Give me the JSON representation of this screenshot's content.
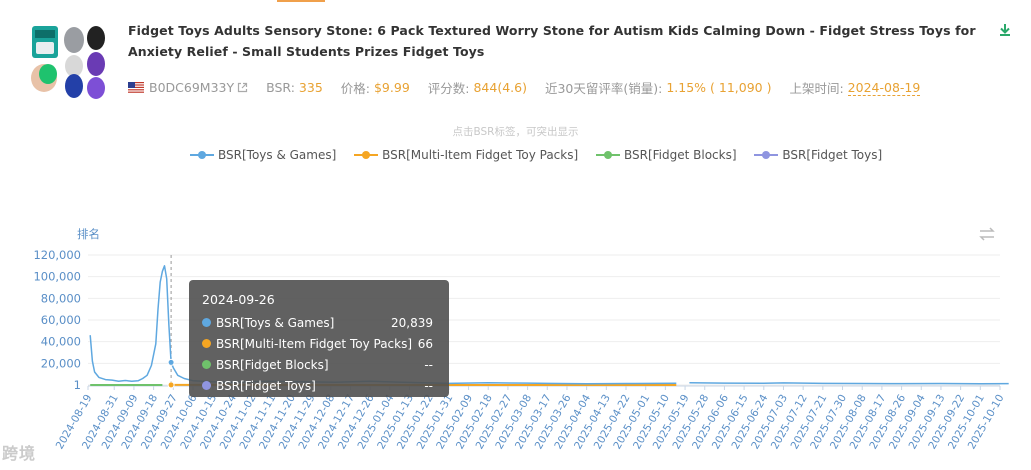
{
  "product": {
    "title": "Fidget Toys Adults Sensory Stone: 6 Pack Textured Worry Stone for Autism Kids Calming Down - Fidget Stress Toys for Anxiety Relief - Small Students Prizes Fidget Toys",
    "asin": "B0DC69M33Y",
    "bsr_label": "BSR:",
    "bsr_value": "335",
    "price_label": "价格:",
    "price_value": "$9.99",
    "reviews_label": "评分数:",
    "reviews_value": "844(4.6)",
    "retention_label": "近30天留评率(销量):",
    "retention_value": "1.15% ( 11,090 )",
    "listed_label": "上架时间:",
    "listed_value": "2024-08-19"
  },
  "chart_hint": "点击BSR标签，可突出显示",
  "axis_title": "排名",
  "legend": [
    {
      "name": "BSR[Toys & Games]",
      "color": "#5fa8e0"
    },
    {
      "name": "BSR[Multi-Item Fidget Toy Packs]",
      "color": "#f5a623"
    },
    {
      "name": "BSR[Fidget Blocks]",
      "color": "#6fc26b"
    },
    {
      "name": "BSR[Fidget Toys]",
      "color": "#8f95e0"
    }
  ],
  "tooltip": {
    "date": "2024-09-26",
    "rows": [
      {
        "name": "BSR[Toys & Games]",
        "value": "20,839",
        "color": "#5fa8e0"
      },
      {
        "name": "BSR[Multi-Item Fidget Toy Packs]",
        "value": "66",
        "color": "#f5a623"
      },
      {
        "name": "BSR[Fidget Blocks]",
        "value": "--",
        "color": "#6fc26b"
      },
      {
        "name": "BSR[Fidget Toys]",
        "value": "--",
        "color": "#8f95e0"
      }
    ]
  },
  "watermark": "跨境",
  "chart_data": {
    "type": "line",
    "ylabel": "排名",
    "y_ticks": [
      "120,000",
      "100,000",
      "80,000",
      "60,000",
      "40,000",
      "20,000",
      "1"
    ],
    "ylim": [
      1,
      120000
    ],
    "x_ticks": [
      "2024-08-19",
      "2024-08-31",
      "2024-09-09",
      "2024-09-18",
      "2024-09-27",
      "2024-10-06",
      "2024-10-15",
      "2024-10-24",
      "2024-11-02",
      "2024-11-11",
      "2024-11-20",
      "2024-11-29",
      "2024-12-08",
      "2024-12-17",
      "2024-12-26",
      "2025-01-04",
      "2025-01-13",
      "2025-01-22",
      "2025-01-31",
      "2025-02-09",
      "2025-02-18",
      "2025-02-27",
      "2025-03-08",
      "2025-03-17",
      "2025-03-26",
      "2025-04-04",
      "2025-04-13",
      "2025-04-22",
      "2025-05-01",
      "2025-05-10",
      "2025-05-19",
      "2025-05-28",
      "2025-06-06",
      "2025-06-15",
      "2025-06-24",
      "2025-07-03",
      "2025-07-12",
      "2025-07-21",
      "2025-07-30",
      "2025-08-08",
      "2025-08-17",
      "2025-08-26",
      "2025-09-04",
      "2025-09-13",
      "2025-09-22",
      "2025-10-01",
      "2025-10-10"
    ],
    "grid": true,
    "legend_position": "top",
    "highlight_date": "2024-09-26",
    "series": [
      {
        "name": "BSR[Toys & Games]",
        "color": "#5fa8e0",
        "points": [
          [
            "2024-08-20",
            46000
          ],
          [
            "2024-08-21",
            22000
          ],
          [
            "2024-08-22",
            12000
          ],
          [
            "2024-08-24",
            7000
          ],
          [
            "2024-08-27",
            5000
          ],
          [
            "2024-08-30",
            4500
          ],
          [
            "2024-09-02",
            3500
          ],
          [
            "2024-09-05",
            4200
          ],
          [
            "2024-09-08",
            3500
          ],
          [
            "2024-09-11",
            4000
          ],
          [
            "2024-09-13",
            6000
          ],
          [
            "2024-09-15",
            9000
          ],
          [
            "2024-09-17",
            18000
          ],
          [
            "2024-09-19",
            38000
          ],
          [
            "2024-09-20",
            70000
          ],
          [
            "2024-09-21",
            95000
          ],
          [
            "2024-09-22",
            105000
          ],
          [
            "2024-09-23",
            110000
          ],
          [
            "2024-09-24",
            98000
          ],
          [
            "2024-09-25",
            55000
          ],
          [
            "2024-09-26",
            20839
          ],
          [
            "2024-09-27",
            16000
          ],
          [
            "2024-09-29",
            9000
          ],
          [
            "2024-10-02",
            6000
          ],
          [
            "2024-10-06",
            4000
          ],
          [
            "2024-10-15",
            3000
          ],
          [
            "2024-10-24",
            2500
          ],
          [
            "2024-11-10",
            3500
          ],
          [
            "2024-11-25",
            3000
          ],
          [
            "2024-12-10",
            2500
          ],
          [
            "2024-12-26",
            3500
          ],
          [
            "2025-01-10",
            2500
          ],
          [
            "2025-01-31",
            1500
          ],
          [
            "2025-02-18",
            2000
          ],
          [
            "2025-03-08",
            1800
          ],
          [
            "2025-03-17",
            1500
          ],
          [
            "2025-04-04",
            1200
          ],
          [
            "2025-04-22",
            1400
          ],
          [
            "2025-05-15",
            1600
          ],
          [
            null,
            null
          ],
          [
            "2025-05-21",
            2000
          ],
          [
            "2025-06-06",
            1800
          ],
          [
            "2025-06-24",
            1600
          ],
          [
            "2025-07-03",
            1900
          ],
          [
            "2025-07-21",
            1500
          ],
          [
            "2025-08-08",
            1400
          ],
          [
            "2025-08-26",
            1300
          ],
          [
            "2025-09-13",
            1400
          ],
          [
            "2025-10-01",
            1200
          ],
          [
            "2025-10-14",
            1300
          ]
        ]
      },
      {
        "name": "BSR[Multi-Item Fidget Toy Packs]",
        "color": "#f5a623",
        "points": [
          [
            "2024-09-26",
            66
          ],
          [
            "2024-10-20",
            60
          ],
          [
            "2025-01-13",
            40
          ],
          [
            "2025-03-17",
            35
          ],
          [
            "2025-05-15",
            40
          ]
        ]
      },
      {
        "name": "BSR[Fidget Blocks]",
        "color": "#6fc26b",
        "points": [
          [
            "2024-08-20",
            30
          ],
          [
            "2024-09-22",
            30
          ]
        ]
      },
      {
        "name": "BSR[Fidget Toys]",
        "color": "#8f95e0",
        "points": [
          [
            "2024-10-10",
            20
          ],
          [
            "2025-01-13",
            20
          ]
        ]
      }
    ]
  }
}
